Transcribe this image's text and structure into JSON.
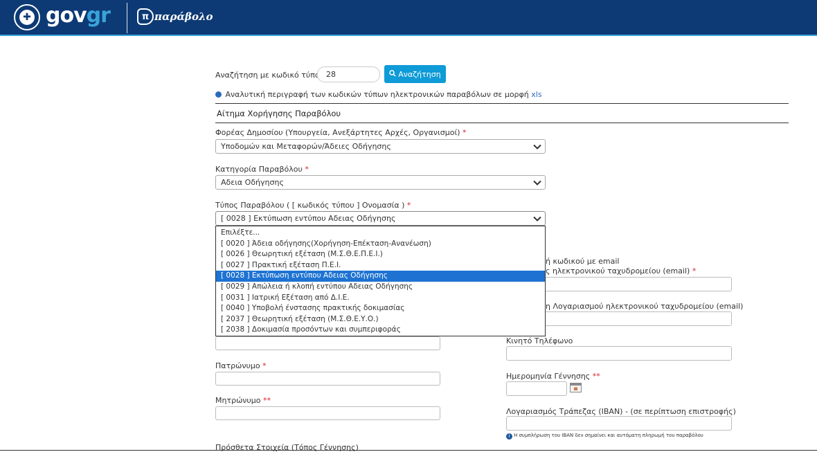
{
  "header": {
    "brand_gov": "gov",
    "brand_gr": "gr",
    "app_name": "παράβολο",
    "app_icon_letter": "π"
  },
  "search": {
    "label": "Αναζήτηση με κωδικό τύπου",
    "value": "28",
    "button_label": "Αναζήτηση"
  },
  "info_link": {
    "text": "Αναλυτική περιγραφή των κωδικών τύπων ηλεκτρονικών παραβόλων σε μορφή",
    "link_text": "xls"
  },
  "section_title": "Αίτημα Χορήγησης Παραβόλου",
  "fields": {
    "foreas": {
      "label": "Φορέας Δημοσίου (Υπουργεία, Ανεξάρτητες Αρχές, Οργανισμοί)",
      "required": "*",
      "value": "Υποδομών και Μεταφορών/Άδειες Οδήγησης"
    },
    "katigoria": {
      "label": "Κατηγορία Παραβόλου",
      "required": "*",
      "value": "Αδεια Οδήγησης"
    },
    "typos": {
      "label": "Τύπος Παραβόλου ( [ κωδικός τύπου ] Ονομασία )",
      "required": "*",
      "value": "[ 0028 ] Εκτύπωση εντύπου Αδειας Οδήγησης"
    },
    "patronymo": {
      "label": "Πατρώνυμο",
      "required": "*"
    },
    "mitronymo": {
      "label": "Μητρώνυμο",
      "required": "**"
    },
    "prostheta": {
      "label": "Πρόσθετα Στοιχεία (Τόπος Γέννησης)"
    },
    "email_notify": {
      "label": "ή κωδικού με email"
    },
    "email": {
      "label": "ς ηλεκτρονικού ταχυδρομείου (email)",
      "required": "*"
    },
    "email_confirm": {
      "label": "η Λογαριασμού ηλεκτρονικού ταχυδρομείου (email)"
    },
    "mobile": {
      "label": "Κινητό Τηλέφωνο"
    },
    "birthdate": {
      "label": "Ημερομηνία Γέννησης",
      "required": "**"
    },
    "iban": {
      "label": "Λογαριασμός Τράπεζας (IBAN) - (σε περίπτωση επιστροφής)",
      "note": "Η συμπλήρωση του IBAN δεν σημαίνει και αυτόματη πληρωμή του παραβόλου"
    }
  },
  "dropdown": {
    "options": [
      "Επιλέξτε...",
      "[ 0020 ] Άδεια οδήγησης(Χορήγηση-Επέκταση-Ανανέωση)",
      "[ 0026 ] Θεωρητική εξέταση (Μ.Σ.Θ.Ε.Π.Ε.Ι.)",
      "[ 0027 ] Πρακτική εξέταση Π.Ε.Ι.",
      "[ 0028 ] Εκτύπωση εντύπου Αδειας Οδήγησης",
      "[ 0029 ] Απώλεια ή κλοπή εντύπου Αδειας Οδήγησης",
      "[ 0031 ] Ιατρική Εξέταση από Δ.Ι.Ε.",
      "[ 0040 ] Υποβολή ένστασης πρακτικής δοκιμασίας",
      "[ 2037 ] Θεωρητική εξέταση (Μ.Σ.Θ.Ε.Υ.Ο.)",
      "[ 2038 ] Δοκιμασία προσόντων και συμπεριφοράς"
    ],
    "selected_index": 4
  },
  "colors": {
    "header_bg": "#0d3a75",
    "accent": "#3aa3d8",
    "button_bg": "#0f9bd7",
    "highlight": "#1e73d2",
    "required": "#d9232d",
    "link": "#2a6bbd"
  }
}
